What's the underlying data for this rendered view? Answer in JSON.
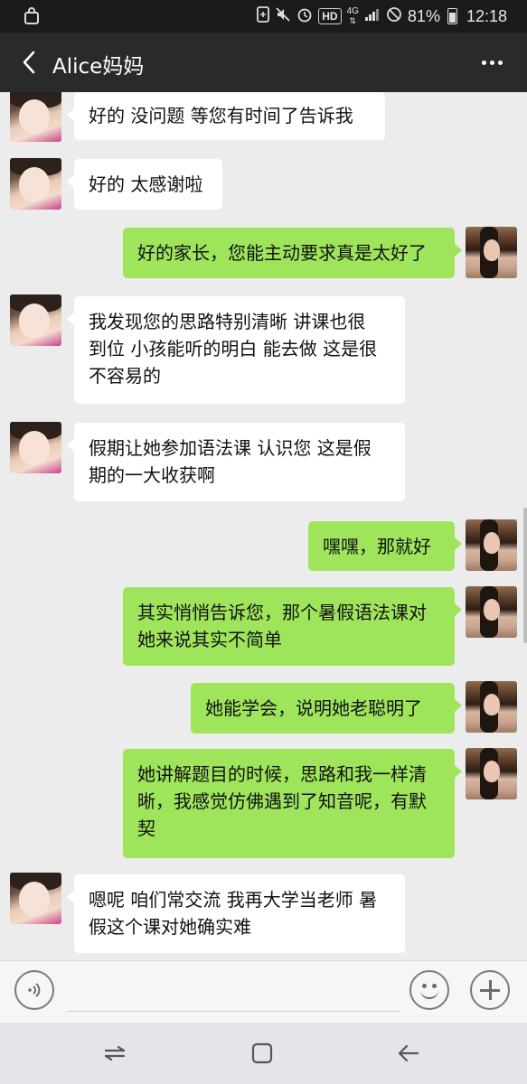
{
  "status_bar": {
    "hd_badge": "HD",
    "network": "4G",
    "battery_percent": "81%",
    "time": "12:18"
  },
  "header": {
    "title": "Alice妈妈",
    "back_icon": "chevron-left-icon",
    "more_icon": "more-dots-icon"
  },
  "messages": [
    {
      "side": "in",
      "lines": [
        "好的 没问题 等您有时间了告诉我"
      ]
    },
    {
      "side": "in",
      "lines": [
        "好的 太感谢啦"
      ]
    },
    {
      "side": "out",
      "lines": [
        "好的家长，您能主动要求真是太好了"
      ]
    },
    {
      "side": "in",
      "lines": [
        "我发现您的思路特别清晰 讲课也很",
        "到位 小孩能听的明白 能去做 这是很",
        "不容易的"
      ]
    },
    {
      "side": "in",
      "lines": [
        "假期让她参加语法课 认识您 这是假",
        "期的一大收获啊"
      ]
    },
    {
      "side": "out",
      "lines": [
        "嘿嘿，那就好"
      ]
    },
    {
      "side": "out",
      "lines": [
        "其实悄悄告诉您，那个暑假语法课对",
        "她来说其实不简单"
      ]
    },
    {
      "side": "out",
      "lines": [
        "她能学会，说明她老聪明了"
      ]
    },
    {
      "side": "out",
      "lines": [
        "她讲解题目的时候，思路和我一样清",
        "晰，我感觉仿佛遇到了知音呢，有默",
        "契"
      ]
    },
    {
      "side": "in",
      "lines": [
        "嗯呢 咱们常交流 我再大学当老师 暑",
        "假这个课对她确实难"
      ]
    }
  ],
  "input_bar": {
    "voice_icon": "voice-icon",
    "message_value": "",
    "emoji_icon": "emoji-icon",
    "plus_icon": "plus-icon"
  },
  "system_nav": {
    "recents_icon": "recents-icon",
    "home_icon": "home-icon",
    "back_icon": "back-arrow-icon"
  }
}
